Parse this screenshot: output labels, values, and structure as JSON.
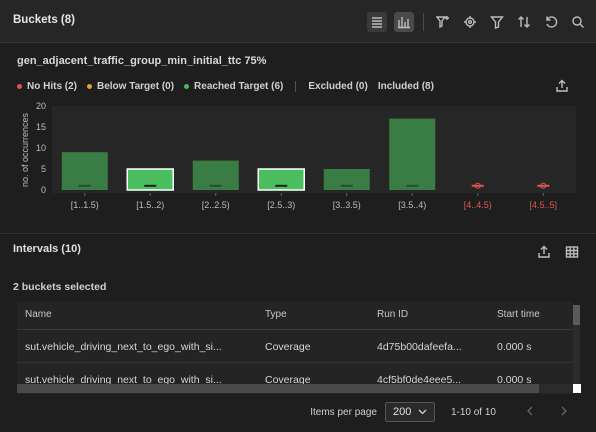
{
  "header": {
    "title": "Buckets (8)"
  },
  "metric": {
    "title": "gen_adjacent_traffic_group_min_initial_ttc 75%"
  },
  "legend": {
    "no_hits": "No Hits (2)",
    "below": "Below Target (0)",
    "reached": "Reached Target (6)",
    "excluded": "Excluded (0)",
    "included": "Included (8)",
    "colors": {
      "no_hits": "#e0564f",
      "below": "#e0a23a",
      "reached": "#3fbf5a"
    }
  },
  "chart_data": {
    "type": "bar",
    "ylabel": "no. of occurrences",
    "ylim": [
      0,
      20
    ],
    "yticks": [
      "0",
      "5",
      "10",
      "15",
      "20"
    ],
    "categories": [
      "[1..1.5)",
      "[1.5..2)",
      "[2..2.5)",
      "[2.5..3)",
      "[3..3.5)",
      "[3.5..4)",
      "[4..4.5)",
      "[4.5..5]"
    ],
    "values": [
      9,
      5,
      7,
      5,
      5,
      17,
      0,
      0
    ],
    "target": [
      1,
      1,
      1,
      1,
      1,
      1,
      1,
      1
    ],
    "selected": [
      false,
      true,
      false,
      true,
      false,
      false,
      false,
      false
    ],
    "no_hit": [
      false,
      false,
      false,
      false,
      false,
      false,
      true,
      true
    ]
  },
  "intervals": {
    "title": "Intervals (10)"
  },
  "selection": {
    "text": "2 buckets selected"
  },
  "table": {
    "columns": [
      "Name",
      "Type",
      "Run ID",
      "Start time"
    ],
    "rows": [
      [
        "sut.vehicle_driving_next_to_ego_with_si...",
        "Coverage",
        "4d75b00dafeefa...",
        "0.000 s"
      ],
      [
        "sut.vehicle_driving_next_to_ego_with_si...",
        "Coverage",
        "4cf5bf0de4eee5...",
        "0.000 s"
      ]
    ]
  },
  "pager": {
    "items_label": "Items per page",
    "per_page": "200",
    "range": "1-10 of 10"
  }
}
